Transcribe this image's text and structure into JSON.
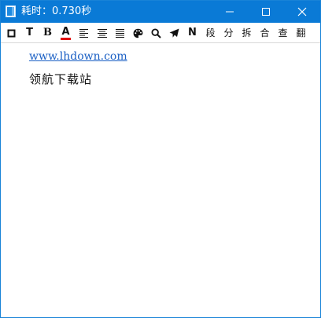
{
  "window": {
    "title": "耗时：0.730秒",
    "accent_color": "#0a7ad6",
    "controls": {
      "minimize_icon": "minimize-icon",
      "maximize_icon": "maximize-icon",
      "close_icon": "close-icon"
    }
  },
  "toolbar": {
    "items": [
      {
        "icon": "square-icon"
      },
      {
        "glyph": "T"
      },
      {
        "glyph": "B"
      },
      {
        "glyph": "A",
        "underline_color": "#e11010"
      },
      {
        "icon": "align-left-icon"
      },
      {
        "icon": "align-center-icon"
      },
      {
        "icon": "align-justify-icon"
      },
      {
        "icon": "palette-icon"
      },
      {
        "icon": "search-icon"
      },
      {
        "icon": "send-icon"
      },
      {
        "glyph": "N"
      },
      {
        "label": "段"
      },
      {
        "label": "分"
      },
      {
        "label": "拆"
      },
      {
        "label": "合"
      },
      {
        "label": "查"
      },
      {
        "label": "翻"
      }
    ]
  },
  "content": {
    "link_text": "www.lhdown.com",
    "line_text": "领航下载站",
    "link_color": "#1a5fc4"
  }
}
